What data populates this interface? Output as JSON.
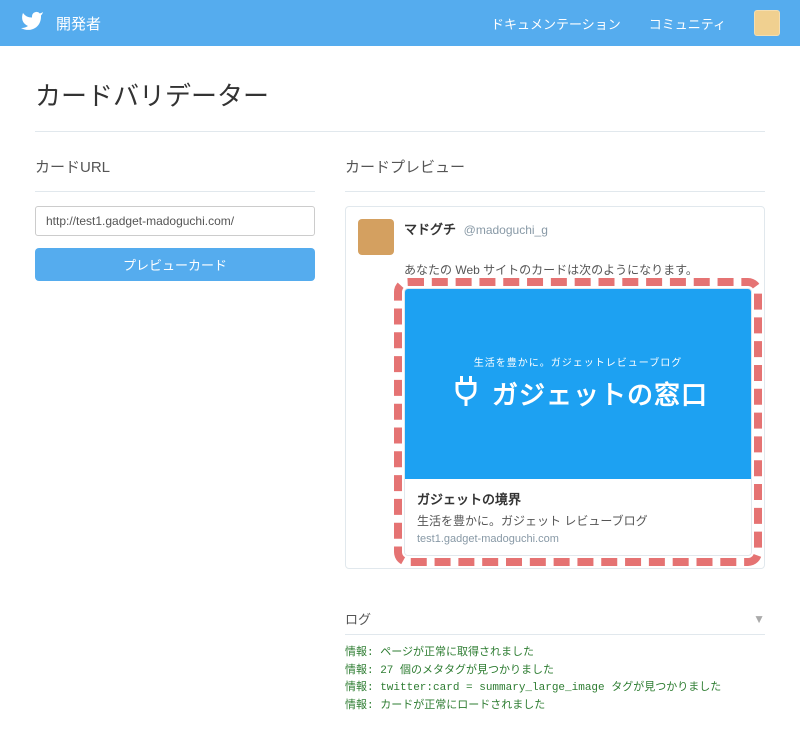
{
  "nav": {
    "brand": "開発者",
    "links": [
      "ドキュメンテーション",
      "コミュニティ"
    ]
  },
  "page": {
    "title": "カードバリデーター"
  },
  "left": {
    "section_title": "カードURL",
    "url_value": "http://test1.gadget-madoguchi.com/",
    "preview_btn": "プレビューカード"
  },
  "right": {
    "section_title": "カードプレビュー",
    "tweet": {
      "name": "マドグチ",
      "handle": "@madoguchi_g",
      "text": "あなたの Web サイトのカードは次のようになります。"
    },
    "card": {
      "image_sub": "生活を豊かに。ガジェットレビューブログ",
      "image_title": "ガジェットの窓口",
      "title": "ガジェットの境界",
      "desc": "生活を豊かに。ガジェット レビューブログ",
      "domain": "test1.gadget-madoguchi.com"
    }
  },
  "log": {
    "title": "ログ",
    "lines": [
      "情報: ページが正常に取得されました",
      "情報: 27 個のメタタグが見つかりました",
      "情報: twitter:card = summary_large_image タグが見つかりました",
      "情報: カードが正常にロードされました"
    ]
  }
}
